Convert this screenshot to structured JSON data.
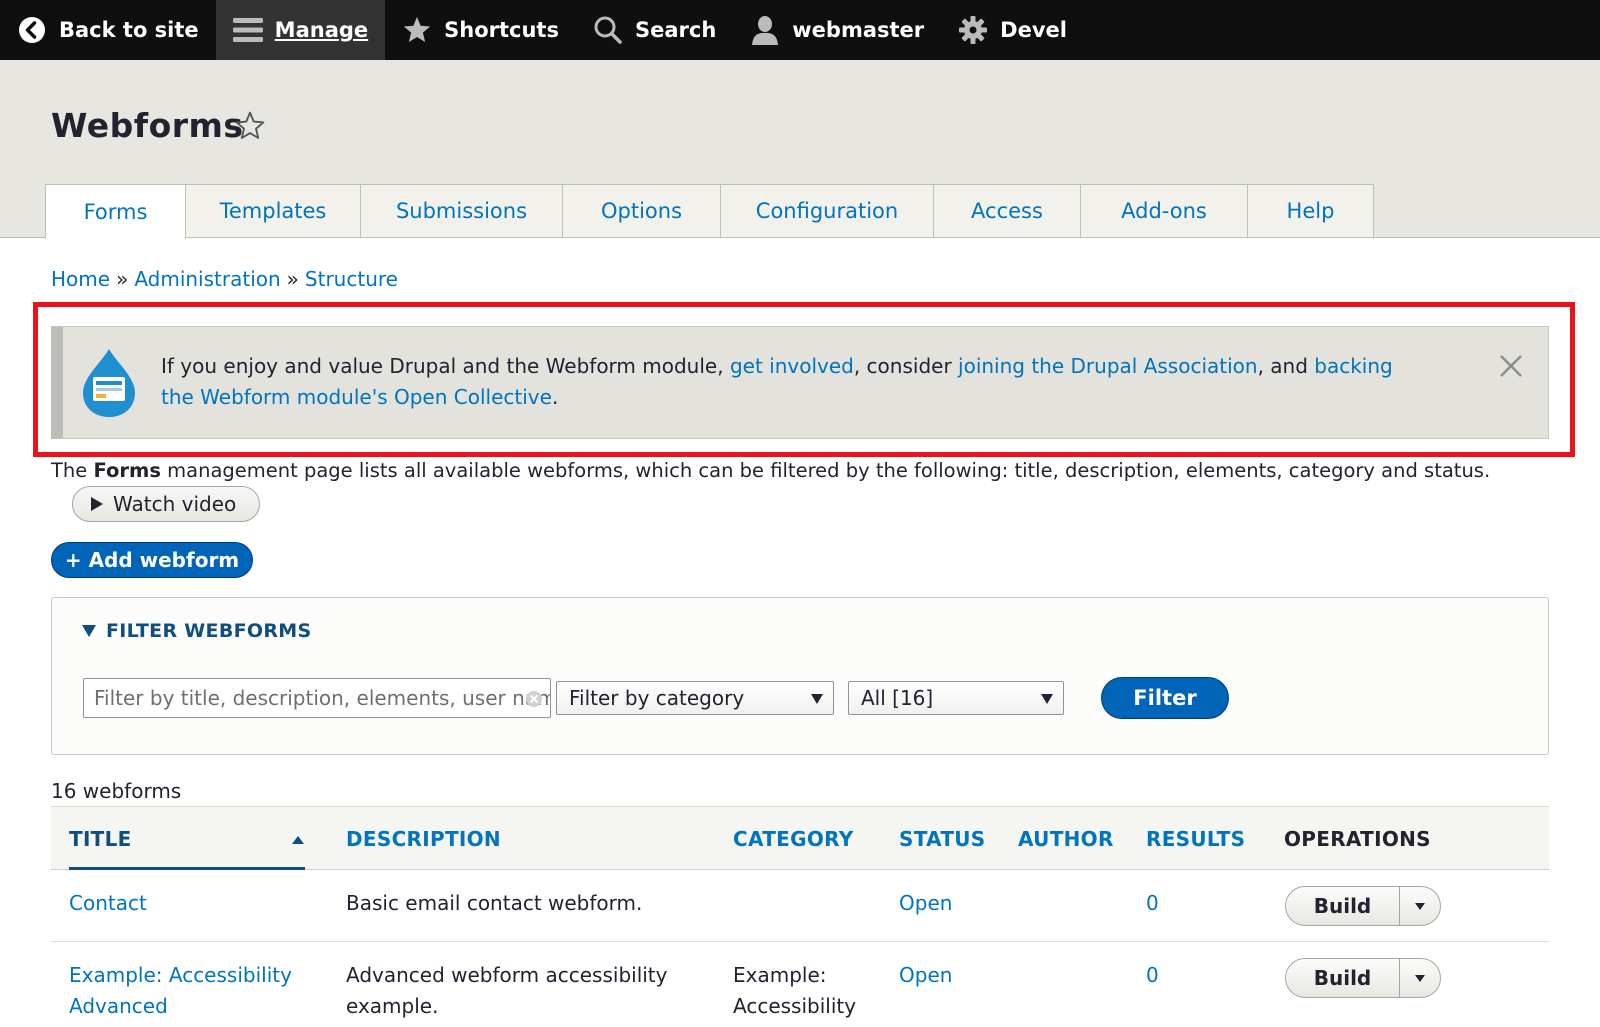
{
  "toolbar": {
    "back": "Back to site",
    "manage": "Manage",
    "shortcuts": "Shortcuts",
    "search": "Search",
    "user": "webmaster",
    "devel": "Devel"
  },
  "page": {
    "title": "Webforms"
  },
  "tabs": [
    {
      "label": "Forms"
    },
    {
      "label": "Templates"
    },
    {
      "label": "Submissions"
    },
    {
      "label": "Options"
    },
    {
      "label": "Configuration"
    },
    {
      "label": "Access"
    },
    {
      "label": "Add-ons"
    },
    {
      "label": "Help"
    }
  ],
  "breadcrumb": {
    "items": [
      "Home",
      "Administration",
      "Structure"
    ],
    "separator": "»"
  },
  "message": {
    "text1": "If you enjoy and value Drupal and the Webform module, ",
    "link1": "get involved",
    "text2": ", consider ",
    "link2": "joining the Drupal Association",
    "text3": ", and ",
    "link3": "backing the Webform module's Open Collective",
    "text4": "."
  },
  "description": {
    "prefix": "The ",
    "bold": "Forms",
    "suffix": " management page lists all available webforms, which can be filtered by the following: title, description, elements, category and status."
  },
  "watch_video": "Watch video",
  "add_webform": "+ Add webform",
  "filter": {
    "legend": "FILTER WEBFORMS",
    "input_placeholder": "Filter by title, description, elements, user name, or role",
    "category_selected": "Filter by category",
    "status_selected": "All [16]",
    "button": "Filter"
  },
  "count": "16 webforms",
  "table": {
    "headers": {
      "title": "TITLE",
      "description": "DESCRIPTION",
      "category": "CATEGORY",
      "status": "STATUS",
      "author": "AUTHOR",
      "results": "RESULTS",
      "operations": "OPERATIONS"
    },
    "rows": [
      {
        "title": "Contact",
        "description": "Basic email contact webform.",
        "category": "",
        "status": "Open",
        "results": "0",
        "operation": "Build"
      },
      {
        "title": "Example: Accessibility Advanced",
        "description": "Advanced webform accessibility example.",
        "category": "Example: Accessibility",
        "status": "Open",
        "results": "0",
        "operation": "Build"
      }
    ]
  },
  "colors": {
    "toolbar_bg": "#0f0f0f",
    "link": "#0074bd",
    "primary_button": "#0065b8",
    "highlight": "#e8141b"
  }
}
